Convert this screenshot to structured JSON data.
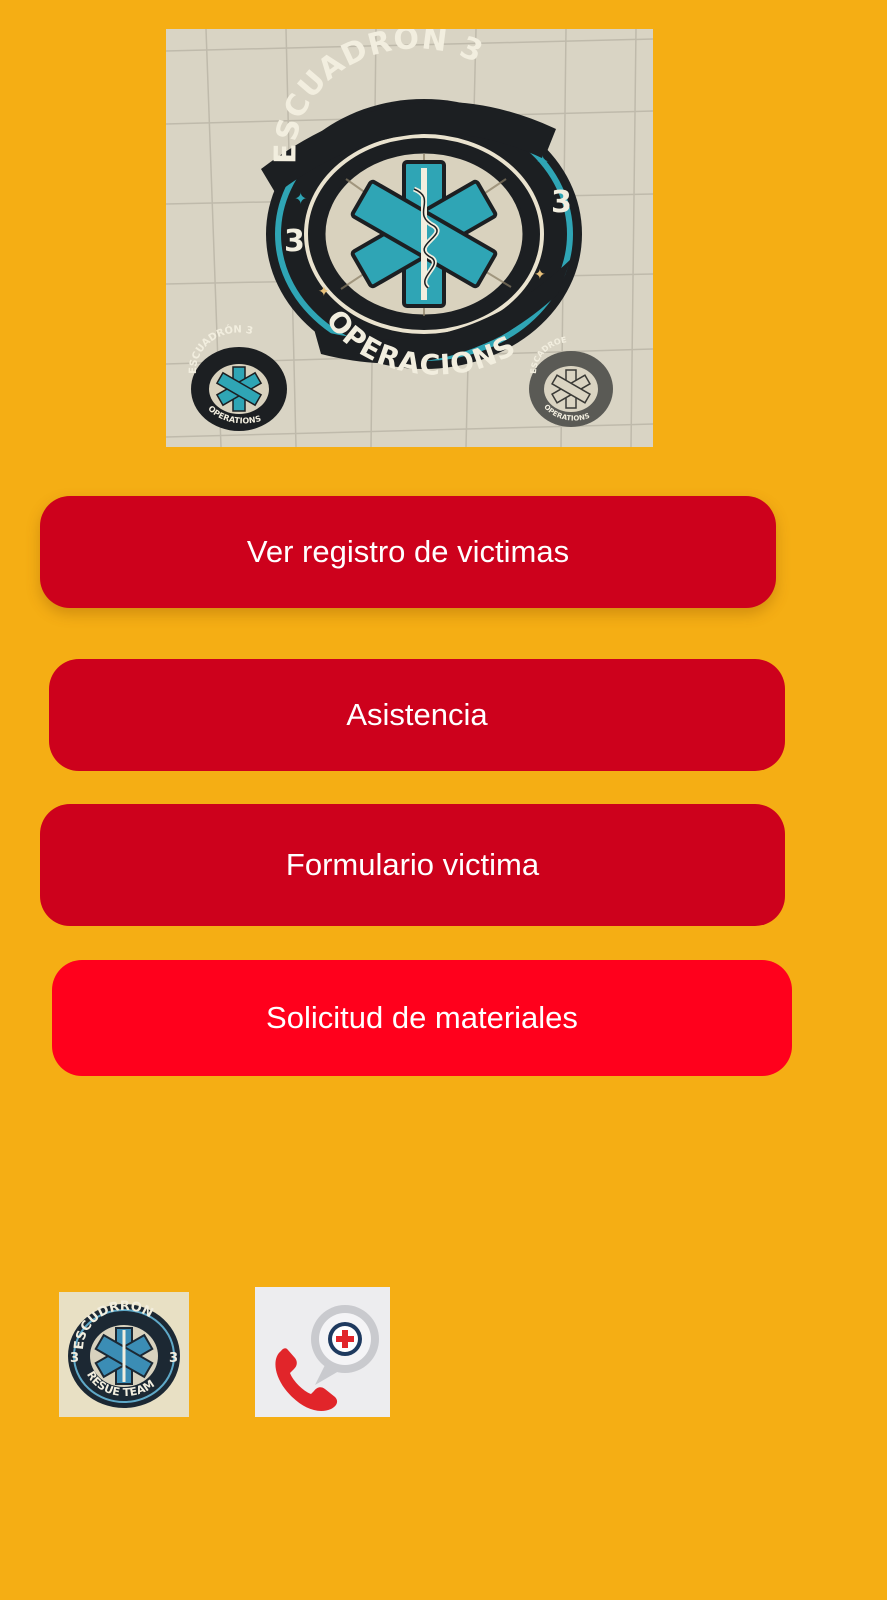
{
  "hero": {
    "icon": "escuadron-3-operations-emblem",
    "emblem_text_top": "ESCUADRON 3",
    "emblem_text_bottom": "OPERACIONS",
    "emblem_side_left": "3",
    "emblem_side_right": "3",
    "small_patch_left_text": "ESCUADRÓN 3",
    "small_patch_left_bottom": "OPERATIONS",
    "small_patch_right_text": "ESCADROE",
    "small_patch_right_bottom": "OPERATIONS"
  },
  "buttons": {
    "registro": "Ver registro de victimas",
    "asistencia": "Asistencia",
    "formulario": "Formulario victima",
    "materiales": "Solicitud de materiales"
  },
  "bottom": {
    "logo": {
      "icon": "escuadron-rescue-team-logo",
      "text_top": "ESCUDRRON",
      "text_bottom": "RESUE TEAM",
      "side_left": "3",
      "side_right": "3"
    },
    "call": {
      "icon": "medical-call-icon"
    }
  },
  "colors": {
    "background": "#F5AE14",
    "button_dark_red": "#CD011C",
    "button_bright_red": "#FF001C",
    "emblem_teal": "#2FA5B5",
    "emblem_dark": "#1C1F22"
  }
}
